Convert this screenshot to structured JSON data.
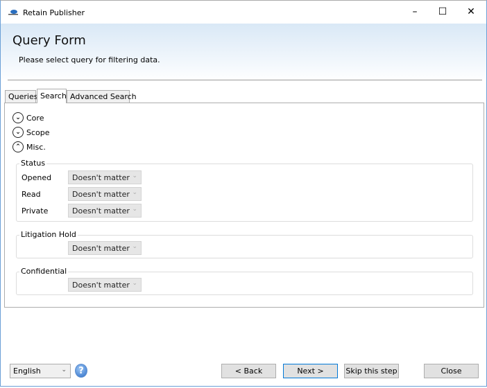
{
  "window": {
    "title": "Retain Publisher",
    "controls": [
      "minimize",
      "maximize",
      "close"
    ]
  },
  "header": {
    "title": "Query Form",
    "subtitle": "Please select query for filtering data."
  },
  "tabs": [
    {
      "label": "Queries"
    },
    {
      "label": "Search",
      "active": true
    },
    {
      "label": "Advanced Search"
    }
  ],
  "expanders": [
    {
      "label": "Core",
      "state": "collapsed"
    },
    {
      "label": "Scope",
      "state": "collapsed"
    },
    {
      "label": "Misc.",
      "state": "expanded"
    }
  ],
  "groups": {
    "status": {
      "title": "Status",
      "fields": [
        {
          "label": "Opened",
          "value": "Doesn't matter"
        },
        {
          "label": "Read",
          "value": "Doesn't matter"
        },
        {
          "label": "Private",
          "value": "Doesn't matter"
        }
      ]
    },
    "litigation": {
      "title": "Litigation Hold",
      "value": "Doesn't matter"
    },
    "confidential": {
      "title": "Confidential",
      "value": "Doesn't matter"
    }
  },
  "footer": {
    "language": "English",
    "help": "?",
    "back": "< Back",
    "next": "Next >",
    "skip": "Skip this step",
    "close": "Close"
  }
}
